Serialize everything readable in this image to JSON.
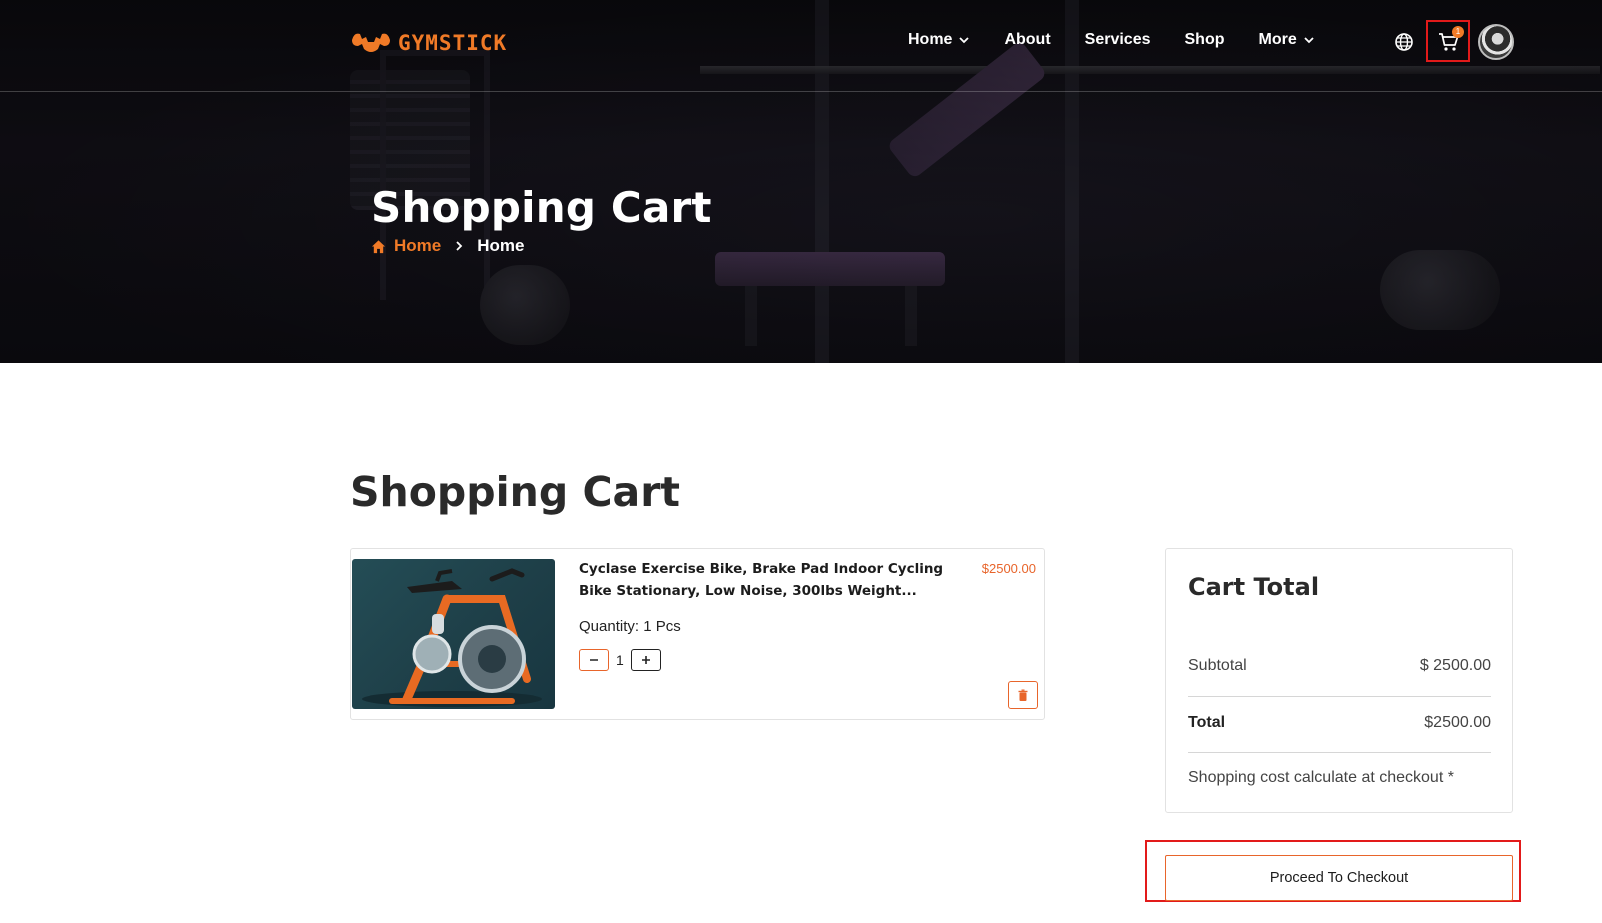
{
  "brand": {
    "name": "GYMSTICK",
    "accent_color": "#f07a27",
    "logo_icon": "muscle-arms-icon"
  },
  "nav": {
    "items": [
      {
        "label": "Home",
        "has_dropdown": true
      },
      {
        "label": "About",
        "has_dropdown": false
      },
      {
        "label": "Services",
        "has_dropdown": false
      },
      {
        "label": "Shop",
        "has_dropdown": false
      },
      {
        "label": "More",
        "has_dropdown": true
      }
    ],
    "icons": [
      "globe-icon",
      "cart-icon",
      "user-avatar"
    ],
    "cart_badge": "1",
    "highlight_color": "#e21a1a"
  },
  "hero": {
    "title": "Shopping Cart",
    "breadcrumb": {
      "home_label": "Home",
      "current_label": "Home"
    }
  },
  "main": {
    "title": "Shopping Cart",
    "cart_items": [
      {
        "name": "Cyclase Exercise Bike, Brake Pad Indoor Cycling Bike Stationary, Low Noise, 300lbs Weight...",
        "price": "$2500.00",
        "quantity_label": "Quantity: 1 Pcs",
        "quantity": "1"
      }
    ]
  },
  "totals": {
    "title": "Cart Total",
    "subtotal_label": "Subtotal",
    "subtotal_value": "$ 2500.00",
    "total_label": "Total",
    "total_value": "$2500.00",
    "shipping_note": "Shopping cost calculate at checkout *",
    "checkout_label": "Proceed To Checkout"
  }
}
